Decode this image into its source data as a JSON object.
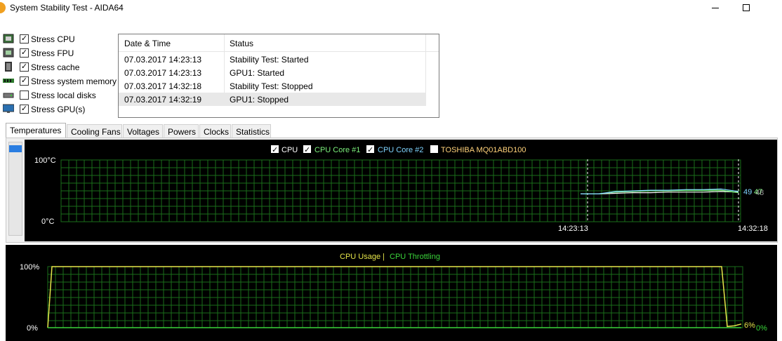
{
  "window": {
    "title": "System Stability Test - AIDA64"
  },
  "stress_options": [
    {
      "label": "Stress CPU",
      "checked": true,
      "icon": "cpu-chip-icon"
    },
    {
      "label": "Stress FPU",
      "checked": true,
      "icon": "fpu-chip-icon"
    },
    {
      "label": "Stress cache",
      "checked": true,
      "icon": "cache-memory-icon"
    },
    {
      "label": "Stress system memory",
      "checked": true,
      "icon": "ram-module-icon"
    },
    {
      "label": "Stress local disks",
      "checked": false,
      "icon": "disk-drive-icon"
    },
    {
      "label": "Stress GPU(s)",
      "checked": true,
      "icon": "monitor-icon"
    }
  ],
  "log": {
    "headers": {
      "datetime": "Date & Time",
      "status": "Status"
    },
    "rows": [
      {
        "datetime": "07.03.2017 14:23:13",
        "status": "Stability Test: Started"
      },
      {
        "datetime": "07.03.2017 14:23:13",
        "status": "GPU1: Started"
      },
      {
        "datetime": "07.03.2017 14:32:18",
        "status": "Stability Test: Stopped"
      },
      {
        "datetime": "07.03.2017 14:32:19",
        "status": "GPU1: Stopped"
      }
    ]
  },
  "tabs": [
    "Temperatures",
    "Cooling Fans",
    "Voltages",
    "Powers",
    "Clocks",
    "Statistics"
  ],
  "temperature_chart": {
    "legend": [
      {
        "label": "CPU",
        "checked": true,
        "color": "#ffffff"
      },
      {
        "label": "CPU Core #1",
        "checked": true,
        "color": "#7cf07c"
      },
      {
        "label": "CPU Core #2",
        "checked": true,
        "color": "#7fd4ff"
      },
      {
        "label": "TOSHIBA MQ01ABD100",
        "checked": false,
        "color": "#ffd27a"
      }
    ],
    "y_max_label": "100°C",
    "y_min_label": "0°C",
    "time_start": "14:23:13",
    "time_end": "14:32:18",
    "current_values": [
      {
        "text": "49",
        "color": "#7fd4ff"
      },
      {
        "text": "47",
        "color": "#7cf07c"
      },
      {
        "text": "48",
        "color": "#ffffff"
      }
    ]
  },
  "usage_chart": {
    "legend_usage": "CPU Usage",
    "legend_separator": "|",
    "legend_throttling": "CPU Throttling",
    "usage_color": "#e6e64a",
    "throttling_color": "#3ad43a",
    "y_max_label": "100%",
    "y_min_label": "0%",
    "current_usage": "6%",
    "current_throttling": "0%"
  },
  "chart_data": [
    {
      "type": "line",
      "title": "",
      "ylim": [
        0,
        100
      ],
      "y_unit": "°C",
      "x_start": "14:23:13",
      "x_end": "14:32:18",
      "series": [
        {
          "name": "CPU",
          "values": [
            45,
            45,
            46,
            47,
            47,
            48,
            48,
            48,
            49,
            48
          ]
        },
        {
          "name": "CPU Core #1",
          "values": [
            45,
            45,
            48,
            49,
            50,
            50,
            51,
            51,
            51,
            47
          ]
        },
        {
          "name": "CPU Core #2",
          "values": [
            45,
            45,
            49,
            50,
            51,
            51,
            52,
            52,
            53,
            49
          ]
        }
      ],
      "grid": true
    },
    {
      "type": "line",
      "title": "",
      "ylim": [
        0,
        100
      ],
      "y_unit": "%",
      "series": [
        {
          "name": "CPU Usage",
          "values": [
            0,
            100,
            100,
            100,
            100,
            100,
            100,
            100,
            100,
            100,
            100,
            2,
            3,
            6
          ]
        },
        {
          "name": "CPU Throttling",
          "values": [
            0,
            0,
            0,
            0,
            0,
            0,
            0,
            0,
            0,
            0,
            0,
            0,
            0,
            0
          ]
        }
      ],
      "grid": true
    }
  ]
}
